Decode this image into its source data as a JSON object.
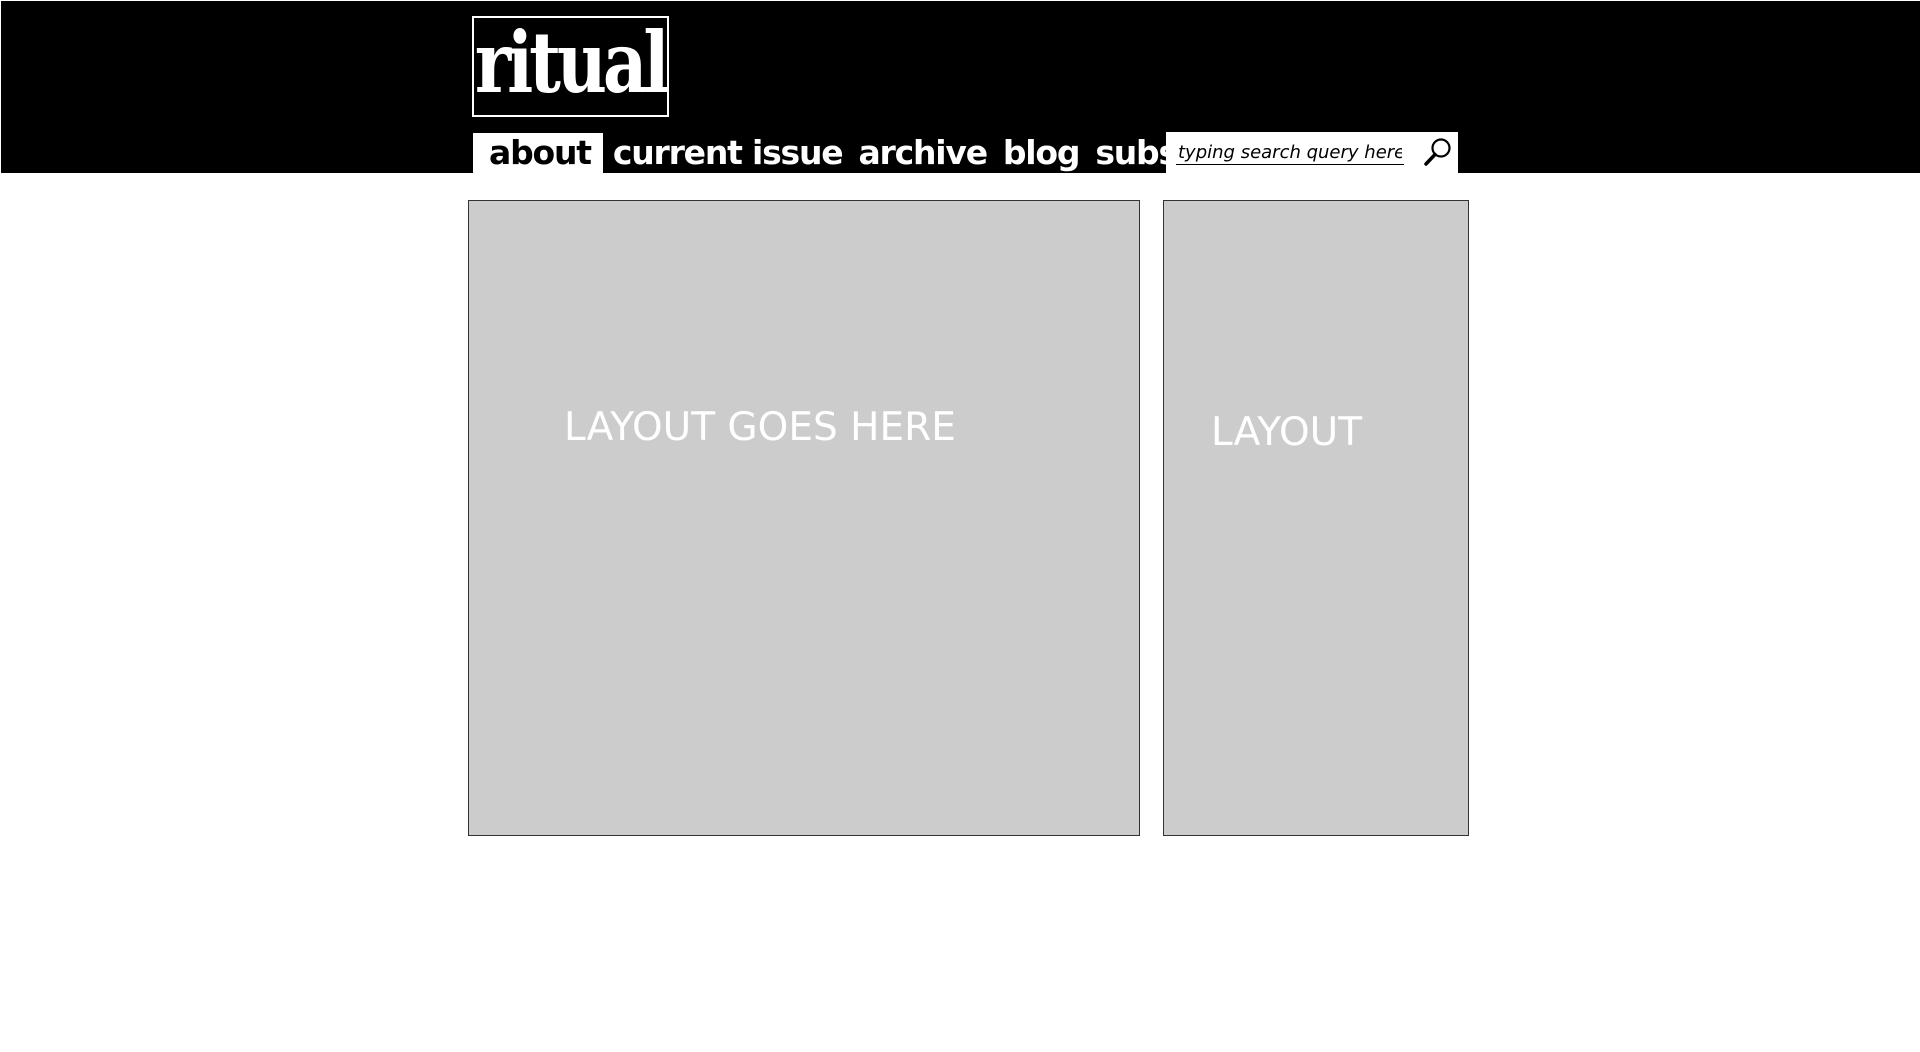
{
  "header": {
    "logo_text": "ritual",
    "background": "#000000"
  },
  "nav": {
    "items": [
      {
        "label": "about",
        "active": true
      },
      {
        "label": "current issue",
        "active": false
      },
      {
        "label": "archive",
        "active": false
      },
      {
        "label": "blog",
        "active": false
      },
      {
        "label": "subscribe",
        "active": false
      }
    ]
  },
  "search": {
    "placeholder": "typing search query here",
    "value": "",
    "icon": "search-icon"
  },
  "main": {
    "primary_placeholder": "LAYOUT GOES HERE",
    "sidebar_placeholder": "LAYOUT",
    "placeholder_fill": "#cccccc"
  }
}
